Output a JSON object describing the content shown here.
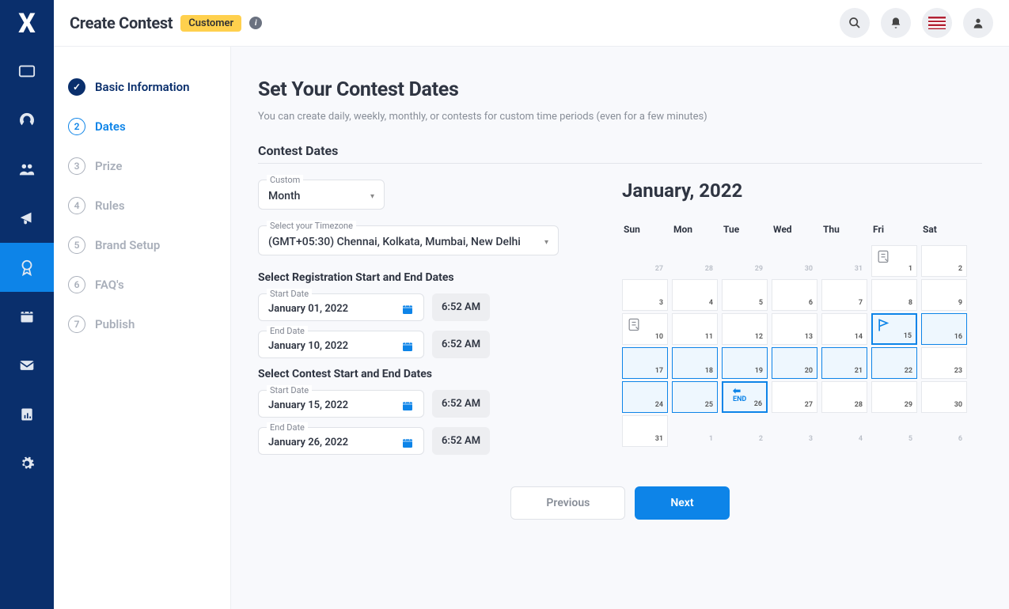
{
  "header": {
    "title": "Create Contest",
    "badge": "Customer"
  },
  "steps": [
    {
      "n": "✓",
      "label": "Basic Information",
      "state": "done"
    },
    {
      "n": "2",
      "label": "Dates",
      "state": "active"
    },
    {
      "n": "3",
      "label": "Prize",
      "state": "pending"
    },
    {
      "n": "4",
      "label": "Rules",
      "state": "pending"
    },
    {
      "n": "5",
      "label": "Brand Setup",
      "state": "pending"
    },
    {
      "n": "6",
      "label": "FAQ's",
      "state": "pending"
    },
    {
      "n": "7",
      "label": "Publish",
      "state": "pending"
    }
  ],
  "page": {
    "heading": "Set Your Contest Dates",
    "sub": "You can create daily, weekly, monthly, or contests for custom time periods (even for a few minutes)",
    "section": "Contest Dates",
    "custom_label": "Custom",
    "custom_value": "Month",
    "tz_label": "Select your Timezone",
    "tz_value": "(GMT+05:30) Chennai, Kolkata, Mumbai, New Delhi",
    "reg_heading": "Select Registration Start and End Dates",
    "contest_heading": "Select Contest Start and End Dates",
    "start_label": "Start Date",
    "end_label": "End Date",
    "reg_start": "January 01, 2022",
    "reg_end": "January 10, 2022",
    "con_start": "January 15, 2022",
    "con_end": "January 26, 2022",
    "time": "6:52 AM",
    "cal_title": "January, 2022",
    "dow": [
      "Sun",
      "Mon",
      "Tue",
      "Wed",
      "Thu",
      "Fri",
      "Sat"
    ],
    "end_text": "END",
    "prev_btn": "Previous",
    "next_btn": "Next"
  },
  "calendar_cells": [
    {
      "d": "27",
      "out": true
    },
    {
      "d": "28",
      "out": true
    },
    {
      "d": "29",
      "out": true
    },
    {
      "d": "30",
      "out": true
    },
    {
      "d": "31",
      "out": true
    },
    {
      "d": "1",
      "ico": "reg"
    },
    {
      "d": "2"
    },
    {
      "d": "3"
    },
    {
      "d": "4"
    },
    {
      "d": "5"
    },
    {
      "d": "6"
    },
    {
      "d": "7"
    },
    {
      "d": "8"
    },
    {
      "d": "9"
    },
    {
      "d": "10",
      "ico": "reg"
    },
    {
      "d": "11"
    },
    {
      "d": "12"
    },
    {
      "d": "13"
    },
    {
      "d": "14"
    },
    {
      "d": "15",
      "hl": true,
      "strong": true,
      "ico": "flag"
    },
    {
      "d": "16",
      "hl": true
    },
    {
      "d": "17",
      "hl": true
    },
    {
      "d": "18",
      "hl": true
    },
    {
      "d": "19",
      "hl": true
    },
    {
      "d": "20",
      "hl": true
    },
    {
      "d": "21",
      "hl": true
    },
    {
      "d": "22",
      "hl": true
    },
    {
      "d": "23"
    },
    {
      "d": "24",
      "hl": true
    },
    {
      "d": "25",
      "hl": true
    },
    {
      "d": "26",
      "hl": true,
      "strong": true,
      "ico": "end"
    },
    {
      "d": "27"
    },
    {
      "d": "28"
    },
    {
      "d": "29"
    },
    {
      "d": "30"
    },
    {
      "d": "31"
    },
    {
      "d": "1",
      "out": true
    },
    {
      "d": "2",
      "out": true
    },
    {
      "d": "3",
      "out": true
    },
    {
      "d": "4",
      "out": true
    },
    {
      "d": "5",
      "out": true
    },
    {
      "d": "6",
      "out": true
    }
  ]
}
